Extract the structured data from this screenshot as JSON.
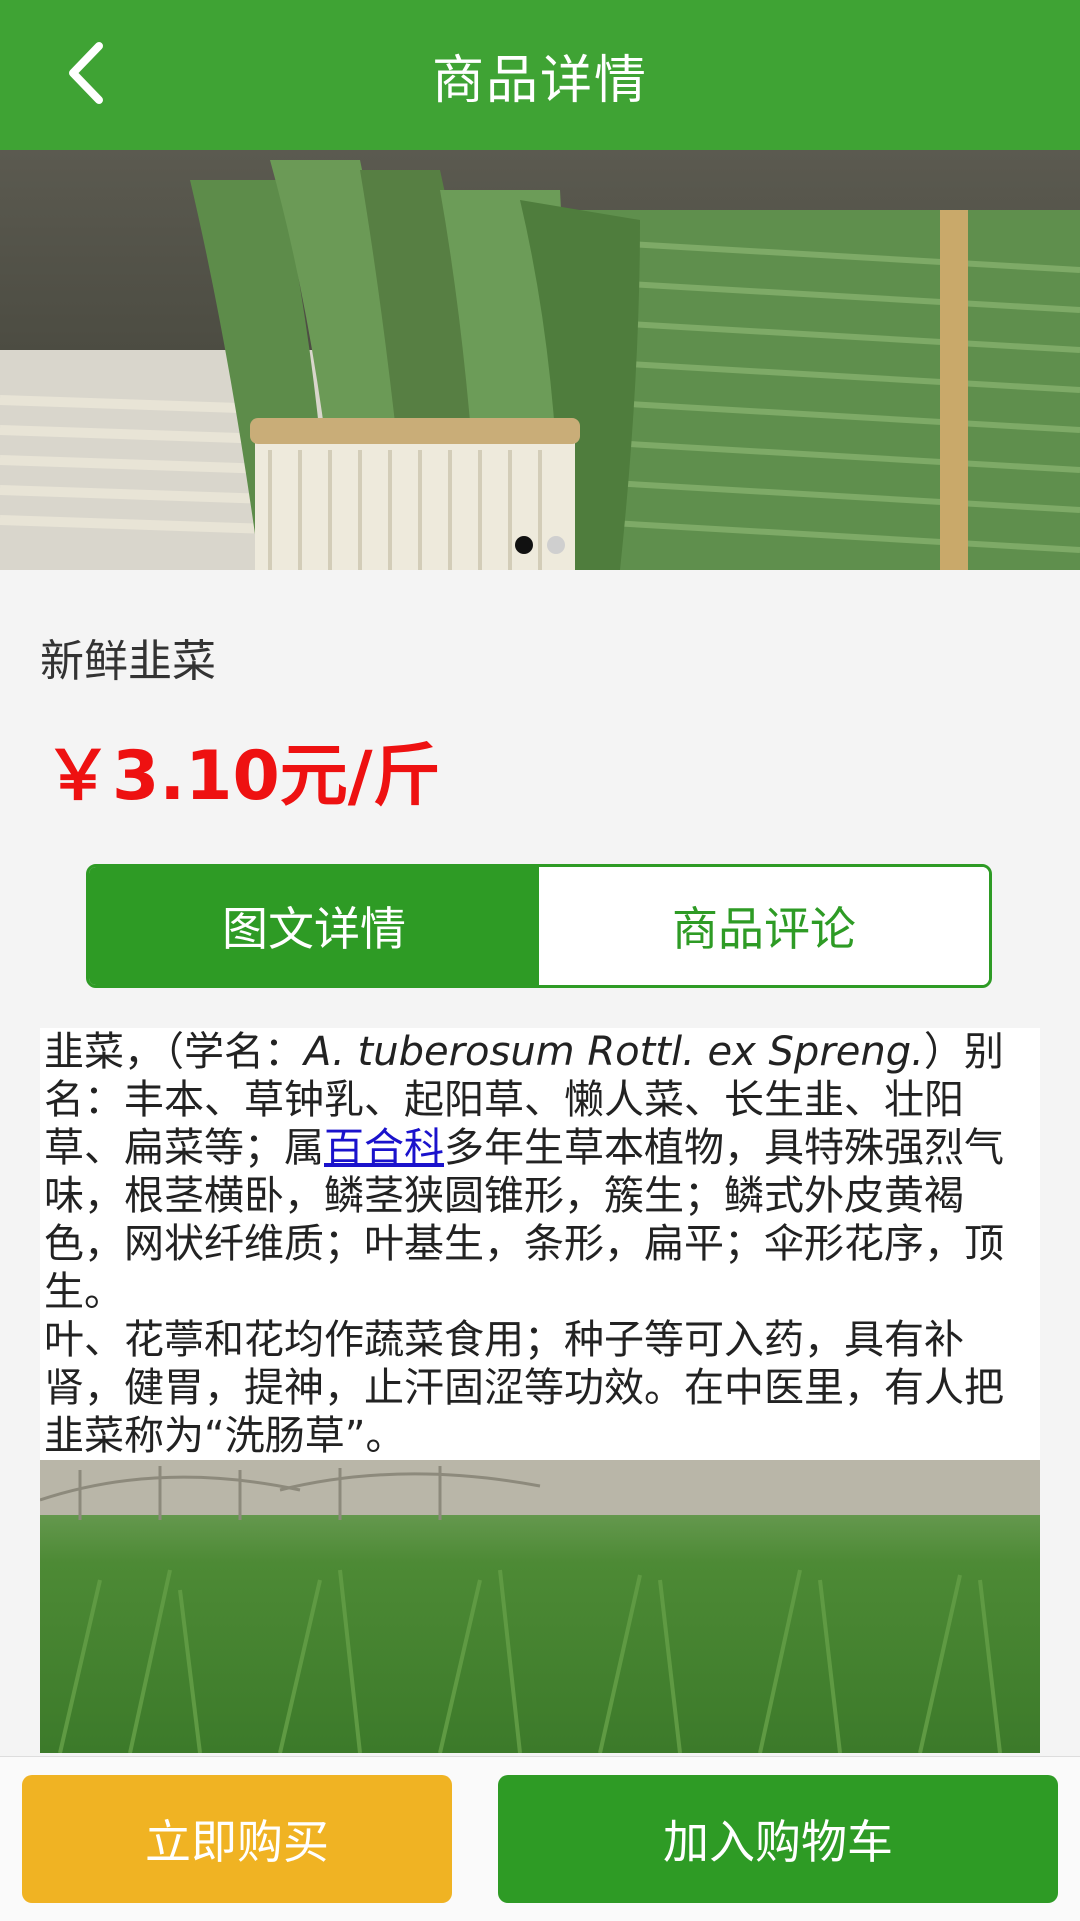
{
  "header": {
    "title": "商品详情",
    "back_icon": "chevron-left-icon"
  },
  "carousel": {
    "image": "chinese-chives-bundle-photo",
    "current_index": 1,
    "total": 2
  },
  "product": {
    "name": "新鲜韭菜",
    "price": "￥3.10元/斤"
  },
  "tabs": [
    {
      "label": "图文详情",
      "active": true
    },
    {
      "label": "商品评论",
      "active": false
    }
  ],
  "description": {
    "p1_a": "韭菜，（学名：",
    "p1_latin": "A. tuberosum Rottl. ex Spreng.",
    "p1_b": "）别名：丰本、草钟乳、起阳草、懒人菜、长生韭、壮阳草、扁菜等；属",
    "p1_link": "百合科",
    "p1_c": "多年生草本植物，具特殊强烈气味，根茎横卧，鳞茎狭圆锥形，簇生；鳞式外皮黄褐色，网状纤维质；叶基生，条形，扁平；伞形花序，顶生。",
    "p2": "叶、花葶和花均作蔬菜食用；种子等可入药，具有补肾，健胃，提神，止汗固涩等功效。在中医里，有人把韭菜称为“洗肠草”。",
    "image": "chive-field-greenhouse-photo"
  },
  "actions": {
    "buy_label": "立即购买",
    "cart_label": "加入购物车"
  },
  "colors": {
    "primary_green": "#3fa334",
    "tab_green": "#2e9b25",
    "price_red": "#ee1111",
    "buy_yellow": "#f0b323"
  }
}
